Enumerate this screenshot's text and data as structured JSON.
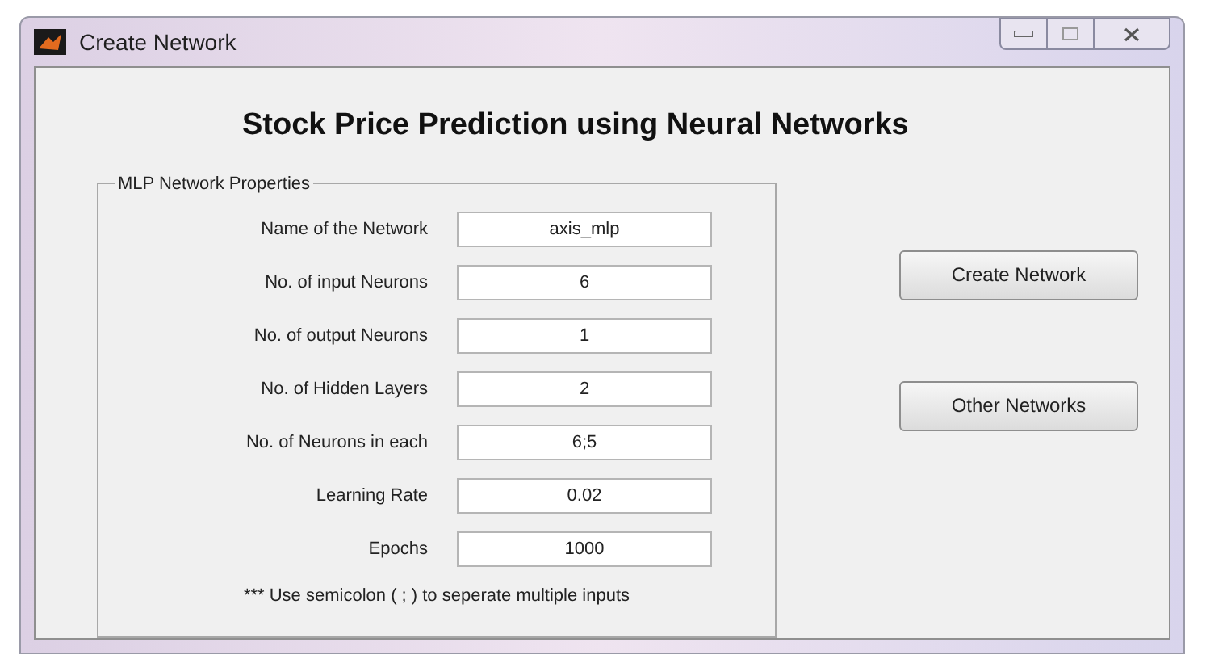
{
  "window": {
    "title": "Create Network"
  },
  "heading": "Stock Price Prediction using Neural Networks",
  "group": {
    "title": "MLP Network Properties",
    "fields": [
      {
        "label": "Name of the Network",
        "value": "axis_mlp"
      },
      {
        "label": "No. of input Neurons",
        "value": "6"
      },
      {
        "label": "No. of output Neurons",
        "value": "1"
      },
      {
        "label": "No. of Hidden Layers",
        "value": "2"
      },
      {
        "label": "No. of Neurons in each",
        "value": "6;5"
      },
      {
        "label": "Learning Rate",
        "value": "0.02"
      },
      {
        "label": "Epochs",
        "value": "1000"
      }
    ],
    "note": "*** Use semicolon ( ; ) to seperate multiple inputs"
  },
  "buttons": [
    "Create Network",
    "Other Networks"
  ]
}
